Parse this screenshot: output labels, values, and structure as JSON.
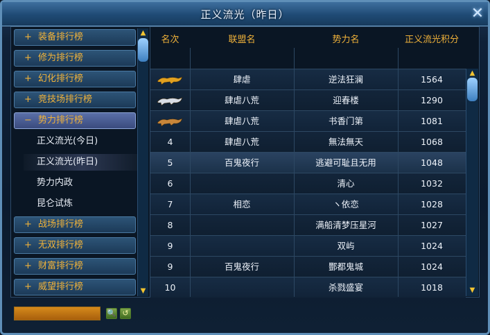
{
  "window": {
    "title": "正义流光（昨日）",
    "close_glyph": "✕"
  },
  "sidebar": {
    "items": [
      {
        "sign": "+",
        "label": "装备排行榜"
      },
      {
        "sign": "+",
        "label": "修为排行榜"
      },
      {
        "sign": "+",
        "label": "幻化排行榜"
      },
      {
        "sign": "+",
        "label": "竞技场排行榜"
      },
      {
        "sign": "−",
        "label": "势力排行榜"
      }
    ],
    "sub_items": [
      {
        "label": "正义流光(今日)"
      },
      {
        "label": "正义流光(昨日)"
      },
      {
        "label": "势力内政"
      },
      {
        "label": "昆仑试炼"
      }
    ],
    "items_after": [
      {
        "sign": "+",
        "label": "战场排行榜"
      },
      {
        "sign": "+",
        "label": "无双排行榜"
      },
      {
        "sign": "+",
        "label": "财富排行榜"
      },
      {
        "sign": "+",
        "label": "威望排行榜"
      }
    ],
    "scroll_up": "▲",
    "scroll_down": "▼"
  },
  "table": {
    "headers": {
      "rank": "名次",
      "alliance": "联盟名",
      "force": "势力名",
      "points": "正义流光积分"
    },
    "rows": [
      {
        "rank": "",
        "rank_icon": "gold-leopard-icon",
        "alliance": "肆虐",
        "force": "逆法狂澜",
        "points": "1564"
      },
      {
        "rank": "",
        "rank_icon": "silver-leopard-icon",
        "alliance": "肆虐八荒",
        "force": "迎春楼",
        "points": "1290"
      },
      {
        "rank": "",
        "rank_icon": "bronze-leopard-icon",
        "alliance": "肆虐八荒",
        "force": "书香门第",
        "points": "1081"
      },
      {
        "rank": "4",
        "alliance": "肆虐八荒",
        "force": "無法無天",
        "points": "1068"
      },
      {
        "rank": "5",
        "alliance": "百鬼夜行",
        "force": "逃避可耻且无用",
        "points": "1048"
      },
      {
        "rank": "6",
        "alliance": "",
        "force": "清心",
        "points": "1032"
      },
      {
        "rank": "7",
        "alliance": "相恋",
        "force": "ヽ依恋",
        "points": "1028"
      },
      {
        "rank": "8",
        "alliance": "",
        "force": "满船清梦压星河",
        "points": "1027"
      },
      {
        "rank": "9",
        "alliance": "",
        "force": "双屿",
        "points": "1024"
      },
      {
        "rank": "9",
        "alliance": "百鬼夜行",
        "force": "酆都鬼城",
        "points": "1024"
      },
      {
        "rank": "10",
        "alliance": "",
        "force": "杀戮盛宴",
        "points": "1018"
      }
    ],
    "scroll_up": "▲",
    "scroll_down": "▼"
  },
  "bottom": {
    "search_value": "",
    "search_icon": "🔍",
    "reset_icon": "↺"
  },
  "colors": {
    "accent": "#f0b23a",
    "gold": "#e0a020",
    "silver": "#d8dde6",
    "bronze": "#c8863a"
  }
}
